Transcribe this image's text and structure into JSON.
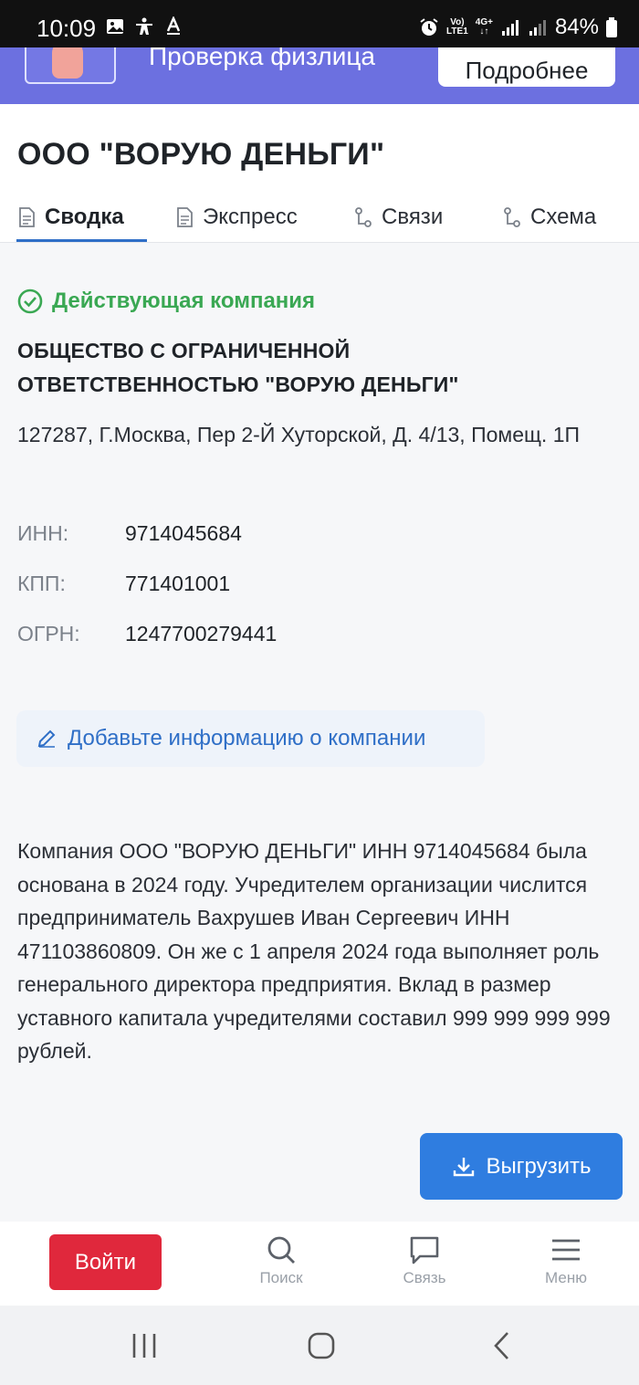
{
  "status_bar": {
    "time": "10:09",
    "battery": "84%",
    "net_top": "Vo)",
    "net_bottom": "LTE1",
    "gen": "4G+"
  },
  "banner": {
    "title": "Проверка физлица",
    "button": "Подробнее"
  },
  "header": {
    "title": "ООО \"ВОРУЮ ДЕНЬГИ\"",
    "tabs": [
      {
        "label": "Сводка",
        "icon": "document-icon",
        "active": true
      },
      {
        "label": "Экспресс",
        "icon": "document-icon",
        "active": false
      },
      {
        "label": "Связи",
        "icon": "link-nodes-icon",
        "active": false
      },
      {
        "label": "Схема",
        "icon": "link-nodes-icon",
        "active": false
      }
    ]
  },
  "company": {
    "status": "Действующая компания",
    "full_name": "ОБЩЕСТВО С ОГРАНИЧЕННОЙ ОТВЕТСТВЕННОСТЬЮ \"ВОРУЮ ДЕНЬГИ\"",
    "address": "127287, Г.Москва, Пер 2-Й Хуторской, Д. 4/13, Помещ. 1П",
    "requisites": [
      {
        "label": "ИНН:",
        "value": "9714045684"
      },
      {
        "label": "КПП:",
        "value": "771401001"
      },
      {
        "label": "ОГРН:",
        "value": "1247700279441"
      }
    ],
    "add_info": "Добавьте информацию о компании",
    "description": "Компания ООО \"ВОРУЮ ДЕНЬГИ\" ИНН 9714045684 была основана в 2024 году. Учредителем организации числится предприниматель Вахрушев Иван Сергеевич ИНН 471103860809. Он же с 1 апреля 2024 года выполняет роль генерального директора предприятия. Вклад в размер уставного капитала учредителями составил 999 999 999 999 рублей.",
    "export": "Выгрузить"
  },
  "bottom_nav": {
    "login": "Войти",
    "items": [
      {
        "label": "Поиск",
        "icon": "search-icon"
      },
      {
        "label": "Связь",
        "icon": "chat-icon"
      },
      {
        "label": "Меню",
        "icon": "menu-icon"
      }
    ]
  },
  "colors": {
    "accent": "#2f7de0",
    "banner": "#6c70e0",
    "active_status": "#3aa853",
    "login": "#e0283c"
  }
}
